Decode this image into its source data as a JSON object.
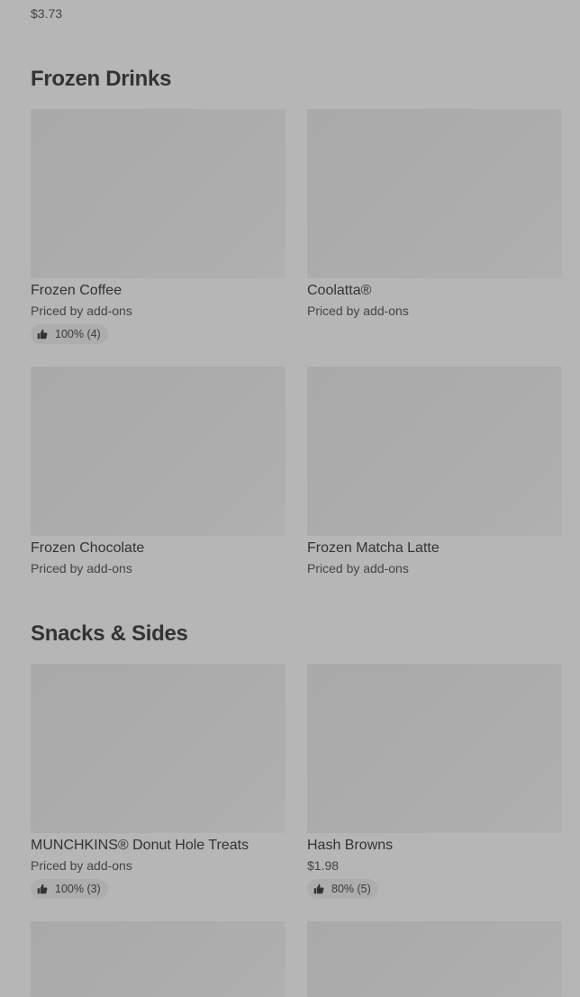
{
  "top": {
    "price": "$3.73"
  },
  "sections": [
    {
      "title": "Frozen Drinks",
      "items": [
        {
          "name": "Frozen Coffee",
          "price": "Priced by add-ons",
          "rating": "100% (4)"
        },
        {
          "name": "Coolatta®",
          "price": "Priced by add-ons"
        },
        {
          "name": "Frozen Chocolate",
          "price": "Priced by add-ons"
        },
        {
          "name": "Frozen Matcha Latte",
          "price": "Priced by add-ons"
        }
      ]
    },
    {
      "title": "Snacks & Sides",
      "items": [
        {
          "name": "MUNCHKINS® Donut Hole Treats",
          "price": "Priced by add-ons",
          "rating": "100% (3)"
        },
        {
          "name": "Hash Browns",
          "price": "$1.98",
          "rating": "80% (5)"
        }
      ]
    }
  ],
  "icons": {
    "rating": "thumbs-up-icon"
  }
}
